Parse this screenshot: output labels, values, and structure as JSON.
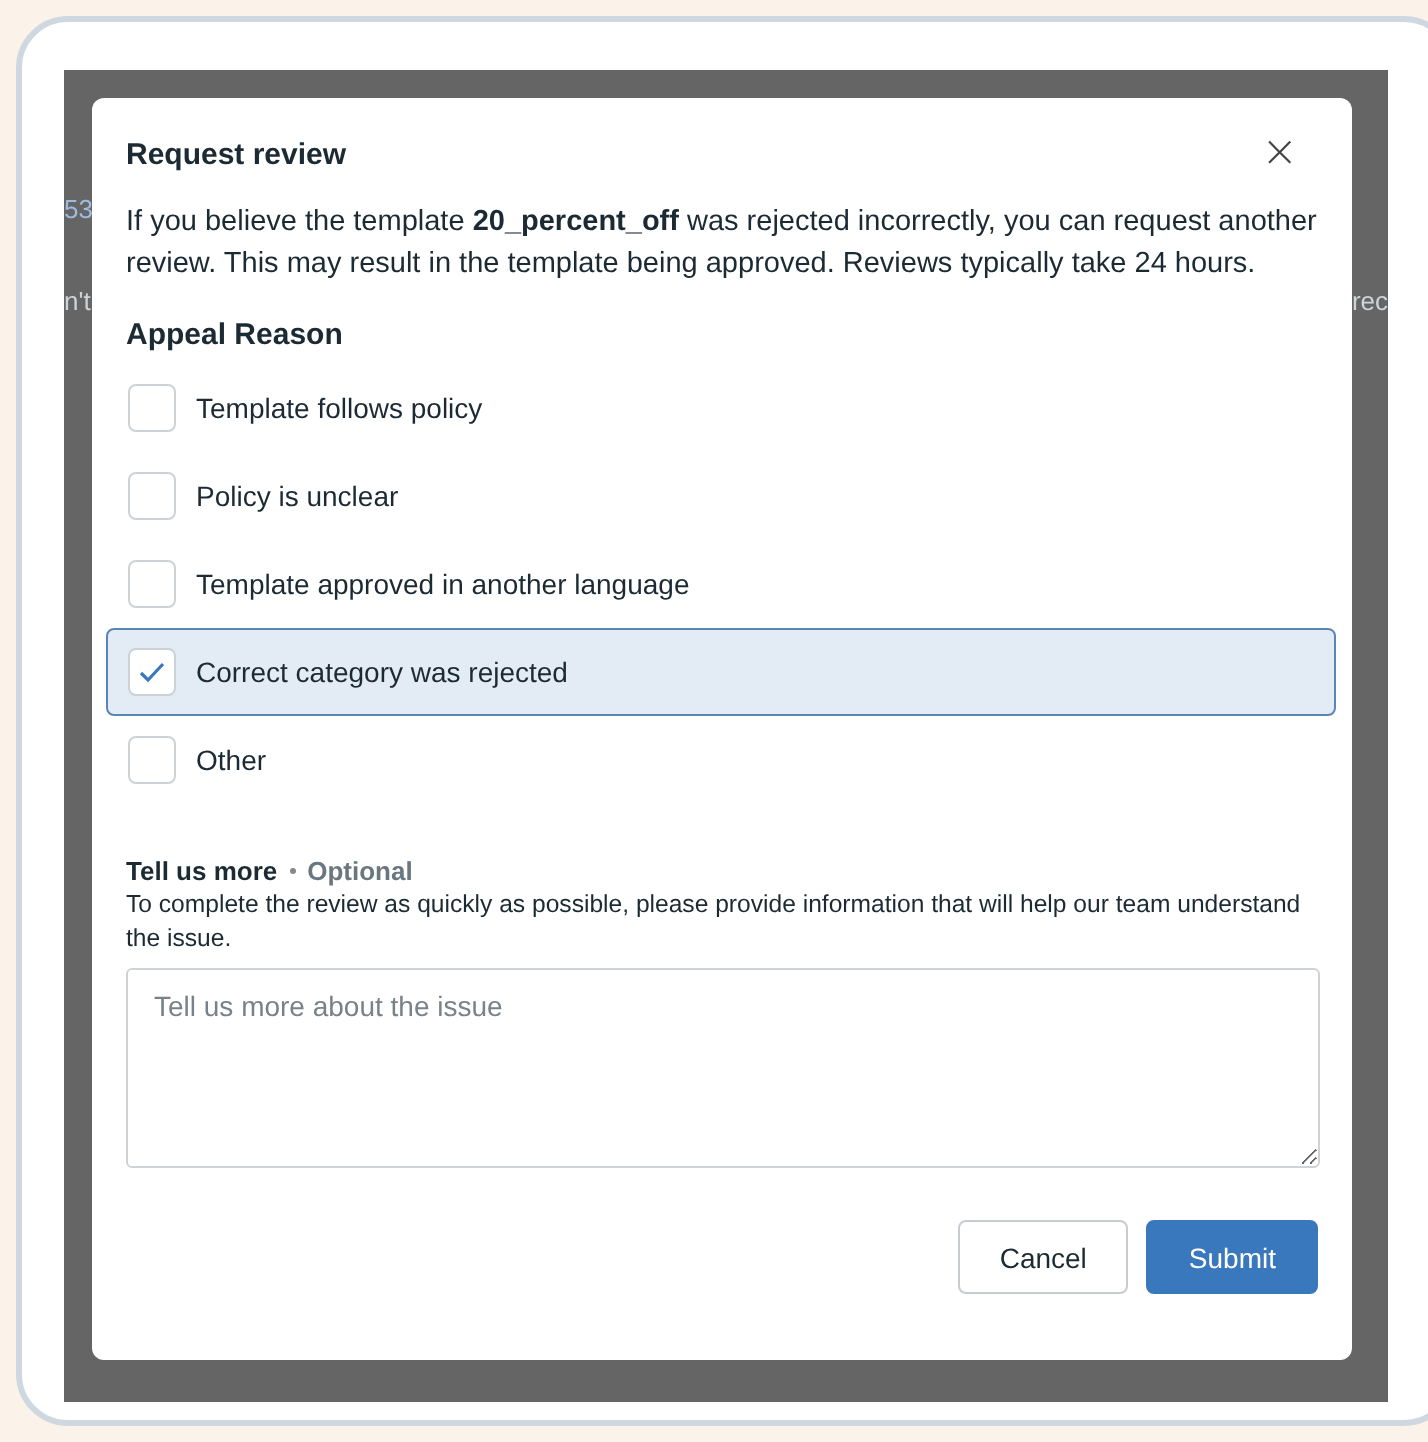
{
  "background": {
    "fragments": [
      {
        "text": "53",
        "kind": "link"
      },
      {
        "text": "n't",
        "kind": "text"
      },
      {
        "text": "rec",
        "kind": "text"
      }
    ]
  },
  "dialog": {
    "title": "Request review",
    "close_label": "×",
    "description": "If you believe the template **20_percent_off** was rejected incorrectly, you can request another review. This may result in the template being approved. Reviews typically take 24 hours.",
    "section_title": "Appeal Reason",
    "options": [
      {
        "label": "Template follows policy",
        "checked": false
      },
      {
        "label": "Policy is unclear",
        "checked": false
      },
      {
        "label": "Template approved in another language",
        "checked": false
      },
      {
        "label": "Correct category was rejected",
        "checked": true
      },
      {
        "label": "Other",
        "checked": false
      }
    ],
    "details": {
      "label": "Tell us more",
      "optional": "Optional",
      "help": "To complete the review as quickly as possible, please provide information that will help our team understand the issue.",
      "placeholder": "Tell us more about the issue"
    },
    "buttons": [
      {
        "label": "Cancel",
        "kind": "secondary"
      },
      {
        "label": "Submit",
        "kind": "primary"
      }
    ]
  }
}
